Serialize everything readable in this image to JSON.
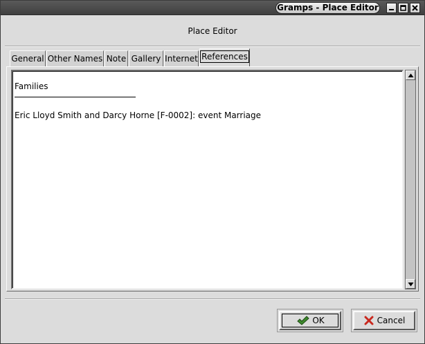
{
  "window": {
    "title": "Gramps - Place Editor",
    "controls": [
      "minimize-icon",
      "maximize-icon",
      "close-icon"
    ]
  },
  "dialog": {
    "heading": "Place Editor"
  },
  "tabs": [
    {
      "label": "General",
      "active": false
    },
    {
      "label": "Other Names",
      "active": false
    },
    {
      "label": "Note",
      "active": false
    },
    {
      "label": "Gallery",
      "active": false
    },
    {
      "label": "Internet",
      "active": false
    },
    {
      "label": "References",
      "active": true
    }
  ],
  "references": {
    "section_title": "Families",
    "items": [
      "Eric Lloyd Smith and Darcy Horne [F-0002]: event Marriage"
    ]
  },
  "buttons": {
    "ok": {
      "label": "OK",
      "icon": "ok-check-icon",
      "color": "#3f8a2e"
    },
    "cancel": {
      "label": "Cancel",
      "icon": "cancel-x-icon",
      "color": "#c8281e"
    }
  }
}
